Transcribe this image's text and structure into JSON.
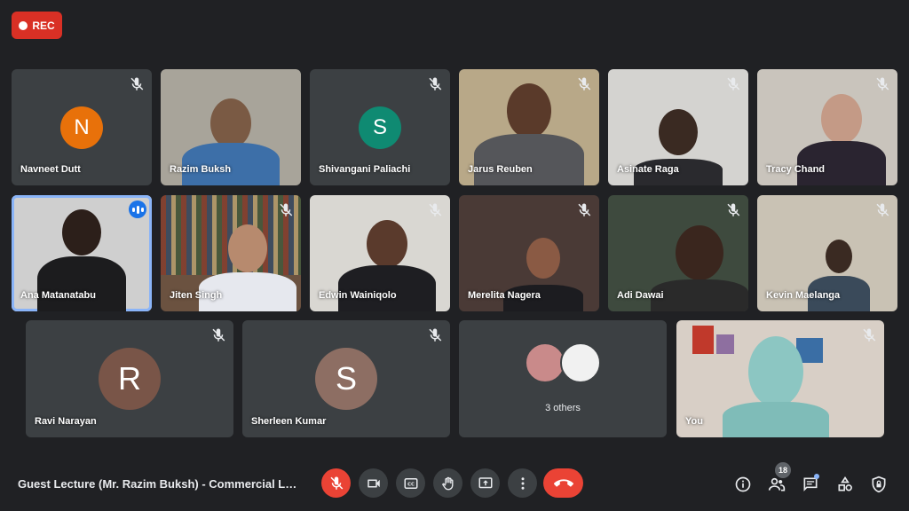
{
  "recording": {
    "label": "REC",
    "color": "#d93025"
  },
  "participants": [
    {
      "name": "Navneet Dutt",
      "avatar_letter": "N",
      "avatar_color": "#e8710a",
      "muted": true
    },
    {
      "name": "Razim Buksh",
      "muted": false
    },
    {
      "name": "Shivangani Paliachi",
      "avatar_letter": "S",
      "avatar_color": "#0f8a72",
      "muted": true
    },
    {
      "name": "Jarus Reuben",
      "muted": true
    },
    {
      "name": "Asinate Raga",
      "muted": true
    },
    {
      "name": "Tracy Chand",
      "muted": true
    },
    {
      "name": "Ana Matanatabu",
      "muted": false,
      "speaking": true
    },
    {
      "name": "Jiten Singh",
      "muted": true
    },
    {
      "name": "Edwin Wainiqolo",
      "muted": true
    },
    {
      "name": "Merelita Nagera",
      "muted": true
    },
    {
      "name": "Adi Dawai",
      "muted": true
    },
    {
      "name": "Kevin Maelanga",
      "muted": true
    },
    {
      "name": "Ravi Narayan",
      "avatar_letter": "R",
      "avatar_color": "#795548",
      "muted": true
    },
    {
      "name": "Sherleen Kumar",
      "avatar_letter": "S",
      "avatar_color": "#8d6e63",
      "muted": true
    },
    {
      "name": "You",
      "muted": true
    }
  ],
  "others_tile": {
    "label": "3 others"
  },
  "bottom_bar": {
    "meeting_title": "Guest Lecture (Mr. Razim Buksh) - Commercial La...",
    "controls": [
      "microphone-off-icon",
      "camera-icon",
      "captions-icon",
      "raise-hand-icon",
      "present-icon",
      "more-options-icon",
      "end-call-icon"
    ],
    "people_count": "18",
    "accent": "#ea4335"
  }
}
